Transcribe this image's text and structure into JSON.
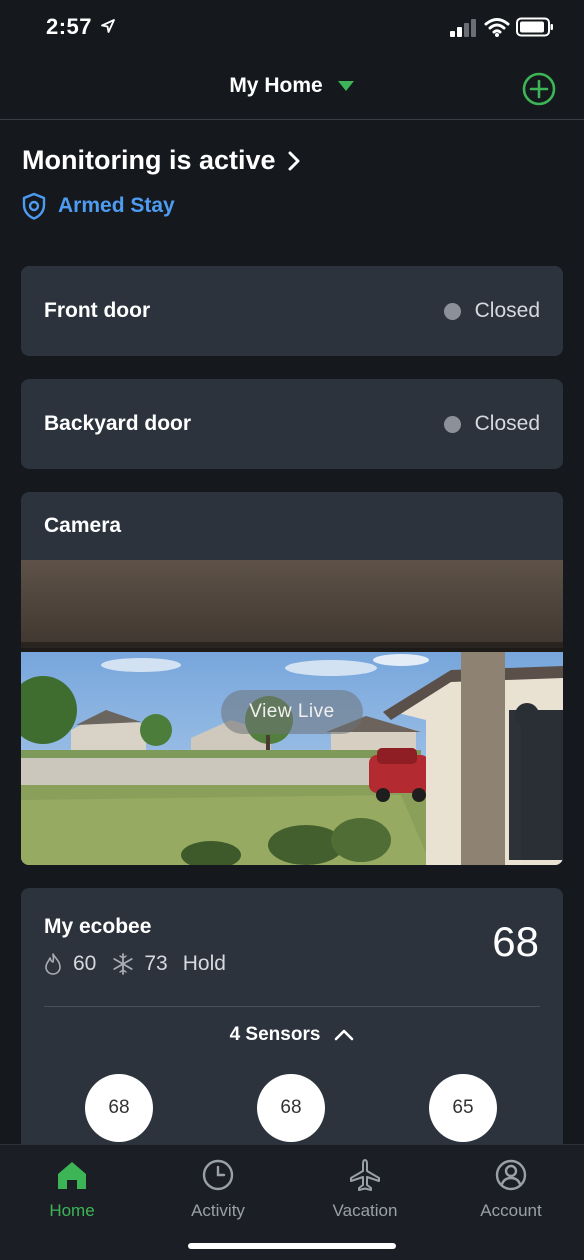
{
  "status_bar": {
    "time": "2:57"
  },
  "header": {
    "home_name": "My Home"
  },
  "monitoring": {
    "title": "Monitoring is active",
    "mode": "Armed Stay"
  },
  "doors": [
    {
      "name": "Front door",
      "status": "Closed"
    },
    {
      "name": "Backyard door",
      "status": "Closed"
    }
  ],
  "camera": {
    "title": "Camera",
    "view_live_label": "View Live"
  },
  "thermostat": {
    "name": "My ecobee",
    "current_temp": "68",
    "heat_setpoint": "60",
    "cool_setpoint": "73",
    "hold_label": "Hold",
    "sensors_label": "4 Sensors",
    "sensors": [
      "68",
      "68",
      "65"
    ]
  },
  "tabs": [
    {
      "label": "Home",
      "icon": "home-icon",
      "active": true
    },
    {
      "label": "Activity",
      "icon": "clock-icon",
      "active": false
    },
    {
      "label": "Vacation",
      "icon": "airplane-icon",
      "active": false
    },
    {
      "label": "Account",
      "icon": "account-icon",
      "active": false
    }
  ],
  "colors": {
    "accent_green": "#3db556",
    "armed_blue": "#4d9cf2",
    "card_bg": "#2c333c",
    "background": "#15181d"
  }
}
